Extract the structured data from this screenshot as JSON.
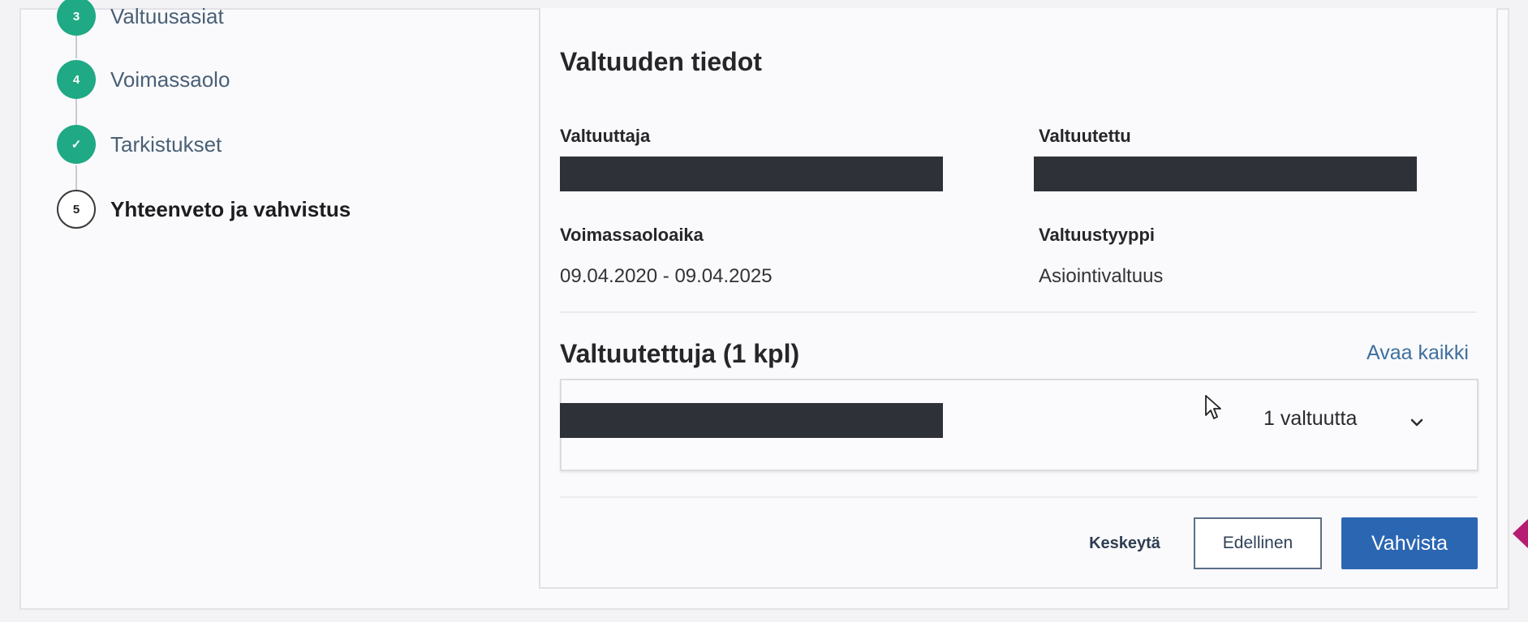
{
  "steps": [
    {
      "number": "3",
      "label": "Valtuusasiat",
      "state": "completed"
    },
    {
      "number": "4",
      "label": "Voimassaolo",
      "state": "completed"
    },
    {
      "number": "✓",
      "label": "Tarkistukset",
      "state": "completed"
    },
    {
      "number": "5",
      "label": "Yhteenveto ja vahvistus",
      "state": "current"
    }
  ],
  "details": {
    "title": "Valtuuden tiedot",
    "grantor_label": "Valtuuttaja",
    "grantee_label": "Valtuutettu",
    "validity_label": "Voimassaoloaika",
    "validity_value": "09.04.2020 - 09.04.2025",
    "type_label": "Valtuustyyppi",
    "type_value": "Asiointivaltuus"
  },
  "grantees": {
    "title": "Valtuutettuja (1 kpl)",
    "expand_all": "Avaa kaikki",
    "item_count": "1 valtuutta"
  },
  "actions": {
    "cancel": "Keskeytä",
    "previous": "Edellinen",
    "confirm": "Vahvista"
  },
  "colors": {
    "step_completed": "#1fa984",
    "primary_button": "#2b66b2",
    "link": "#3f6f9e",
    "redaction": "#2e3238",
    "edge_marker": "#b51c72"
  },
  "icons": {
    "check": "check-icon",
    "chevron": "chevron-down-icon",
    "cursor": "mouse-cursor-icon"
  }
}
